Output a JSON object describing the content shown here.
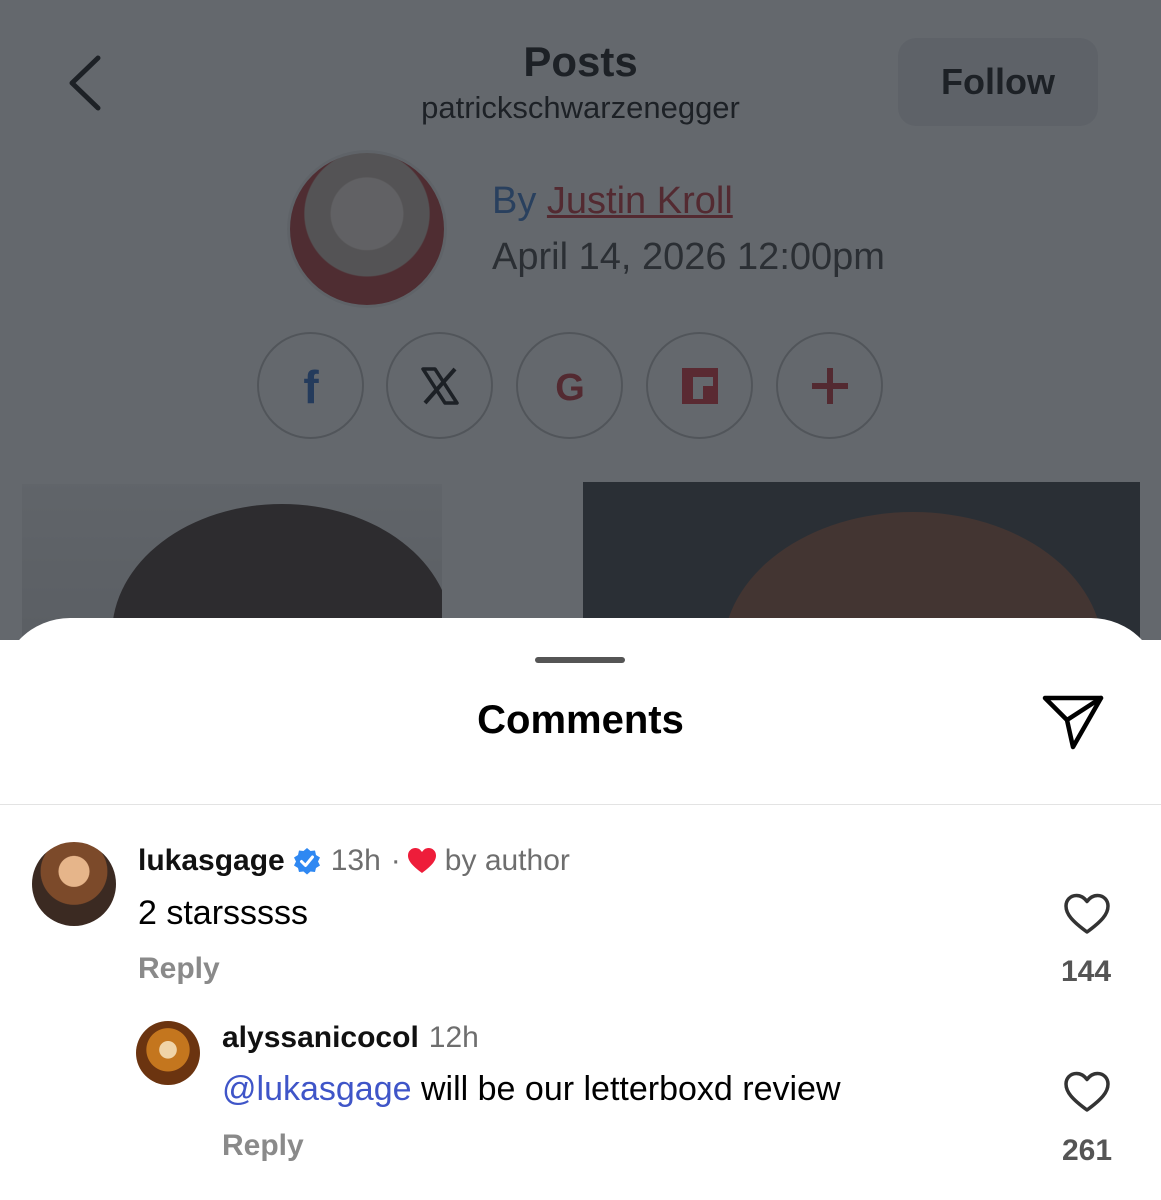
{
  "header": {
    "title": "Posts",
    "subtitle": "patrickschwarzenegger",
    "follow_label": "Follow"
  },
  "article": {
    "by_prefix": "By",
    "author": "Justin Kroll",
    "date": "April 14, 2026 12:00pm",
    "share_buttons": [
      {
        "icon": "facebook-icon",
        "glyph": "f"
      },
      {
        "icon": "x-icon",
        "glyph": "X"
      },
      {
        "icon": "google-icon",
        "glyph": "G"
      },
      {
        "icon": "flipboard-icon",
        "glyph": ""
      },
      {
        "icon": "plus-icon",
        "glyph": "+"
      }
    ]
  },
  "sheet": {
    "title": "Comments"
  },
  "comments": [
    {
      "username": "lukasgage",
      "verified": true,
      "time": "13h",
      "separator": "·",
      "liked_by_author": "by author",
      "text": "2 starsssss",
      "reply_label": "Reply",
      "likes": "144"
    },
    {
      "username": "alyssanicocol",
      "time": "12h",
      "mention": "@lukasgage",
      "text": " will be our letterboxd review",
      "reply_label": "Reply",
      "likes": "261"
    }
  ],
  "colors": {
    "mention": "#3f55c8",
    "heart_red": "#ee1d3a",
    "verified_blue": "#2f88f2",
    "link_blue": "#2b71c9",
    "author_red": "#c0202a"
  }
}
